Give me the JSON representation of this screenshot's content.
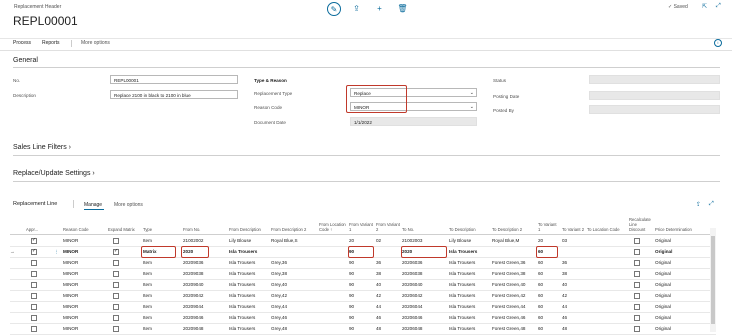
{
  "header": {
    "breadcrumb": "Replacement Header",
    "title": "REPL00001",
    "saved_label": "Saved",
    "icons": [
      "edit-icon",
      "share-icon",
      "add-icon",
      "delete-icon",
      "check-icon",
      "open-new-icon",
      "collapse-icon"
    ]
  },
  "actions": {
    "process": "Process",
    "reports": "Reports",
    "more": "More options"
  },
  "general": {
    "title": "General",
    "no_label": "No.",
    "no_value": "REPL00001",
    "desc_label": "Description",
    "desc_value": "Replace 2100 in black to 2100 in blue",
    "type_reason_title": "Type & Reason",
    "rtype_label": "Replacement Type",
    "rtype_value": "Replace",
    "reason_label": "Reason Code",
    "reason_value": "MINOR",
    "docdate_label": "Document Date",
    "docdate_value": "1/1/2022",
    "status_label": "Status",
    "posting_label": "Posting Date",
    "posted_label": "Posted By"
  },
  "sections": {
    "sales_filters": "Sales Line Filters",
    "replace_settings": "Replace/Update Settings"
  },
  "lines": {
    "title": "Replacement Line",
    "manage": "Manage",
    "more": "More options",
    "columns": [
      "Appr...",
      "Reason Code",
      "Expand Matrix",
      "Type",
      "From No.",
      "From Description",
      "From Description 2",
      "From Location Code ↑",
      "From Variant 1",
      "From Variant 2",
      "To No.",
      "To Description",
      "To Description 2",
      "To Variant 1",
      "To Variant 2",
      "To Location Code",
      "Recalculate Line Discount",
      "Price Determination"
    ],
    "rows": [
      {
        "appr": true,
        "reason": "MINOR",
        "expand": false,
        "type": "Item",
        "from_no": "21002002",
        "from_desc": "Lily Blouse",
        "from_desc2": "Royal Blue,S",
        "from_loc": "",
        "fv1": "20",
        "fv2": "02",
        "to_no": "21002003",
        "to_desc": "Lily Blouse",
        "to_desc2": "Royal Blue,M",
        "tv1": "20",
        "tv2": "03",
        "to_loc": "",
        "recalc": false,
        "price": "Original",
        "bold": false
      },
      {
        "appr": true,
        "reason": "MINOR",
        "expand": true,
        "type": "Matrix",
        "from_no": "2020",
        "from_desc": "Isla Trousers",
        "from_desc2": "",
        "from_loc": "",
        "fv1": "90",
        "fv2": "",
        "to_no": "2020",
        "to_desc": "Isla Trousers",
        "to_desc2": "",
        "tv1": "60",
        "tv2": "",
        "to_loc": "",
        "recalc": false,
        "price": "Original",
        "bold": true
      },
      {
        "appr": false,
        "reason": "MINOR",
        "expand": false,
        "type": "Item",
        "from_no": "20209036",
        "from_desc": "Isla Trousers",
        "from_desc2": "Grey,36",
        "from_loc": "",
        "fv1": "90",
        "fv2": "36",
        "to_no": "20206036",
        "to_desc": "Isla Trousers",
        "to_desc2": "Forest Green,36",
        "tv1": "60",
        "tv2": "36",
        "to_loc": "",
        "recalc": false,
        "price": "Original",
        "bold": false
      },
      {
        "appr": false,
        "reason": "MINOR",
        "expand": false,
        "type": "Item",
        "from_no": "20209038",
        "from_desc": "Isla Trousers",
        "from_desc2": "Grey,38",
        "from_loc": "",
        "fv1": "90",
        "fv2": "38",
        "to_no": "20206038",
        "to_desc": "Isla Trousers",
        "to_desc2": "Forest Green,38",
        "tv1": "60",
        "tv2": "38",
        "to_loc": "",
        "recalc": false,
        "price": "Original",
        "bold": false
      },
      {
        "appr": false,
        "reason": "MINOR",
        "expand": false,
        "type": "Item",
        "from_no": "20209040",
        "from_desc": "Isla Trousers",
        "from_desc2": "Grey,40",
        "from_loc": "",
        "fv1": "90",
        "fv2": "40",
        "to_no": "20206040",
        "to_desc": "Isla Trousers",
        "to_desc2": "Forest Green,40",
        "tv1": "60",
        "tv2": "40",
        "to_loc": "",
        "recalc": false,
        "price": "Original",
        "bold": false
      },
      {
        "appr": false,
        "reason": "MINOR",
        "expand": false,
        "type": "Item",
        "from_no": "20209042",
        "from_desc": "Isla Trousers",
        "from_desc2": "Grey,42",
        "from_loc": "",
        "fv1": "90",
        "fv2": "42",
        "to_no": "20206042",
        "to_desc": "Isla Trousers",
        "to_desc2": "Forest Green,42",
        "tv1": "60",
        "tv2": "42",
        "to_loc": "",
        "recalc": false,
        "price": "Original",
        "bold": false
      },
      {
        "appr": false,
        "reason": "MINOR",
        "expand": false,
        "type": "Item",
        "from_no": "20209044",
        "from_desc": "Isla Trousers",
        "from_desc2": "Grey,44",
        "from_loc": "",
        "fv1": "90",
        "fv2": "44",
        "to_no": "20206044",
        "to_desc": "Isla Trousers",
        "to_desc2": "Forest Green,44",
        "tv1": "60",
        "tv2": "44",
        "to_loc": "",
        "recalc": false,
        "price": "Original",
        "bold": false
      },
      {
        "appr": false,
        "reason": "MINOR",
        "expand": false,
        "type": "Item",
        "from_no": "20209046",
        "from_desc": "Isla Trousers",
        "from_desc2": "Grey,46",
        "from_loc": "",
        "fv1": "90",
        "fv2": "46",
        "to_no": "20206046",
        "to_desc": "Isla Trousers",
        "to_desc2": "Forest Green,46",
        "tv1": "60",
        "tv2": "46",
        "to_loc": "",
        "recalc": false,
        "price": "Original",
        "bold": false
      },
      {
        "appr": false,
        "reason": "MINOR",
        "expand": false,
        "type": "Item",
        "from_no": "20209048",
        "from_desc": "Isla Trousers",
        "from_desc2": "Grey,48",
        "from_loc": "",
        "fv1": "90",
        "fv2": "48",
        "to_no": "20206048",
        "to_desc": "Isla Trousers",
        "to_desc2": "Forest Green,48",
        "tv1": "60",
        "tv2": "48",
        "to_loc": "",
        "recalc": false,
        "price": "Original",
        "bold": false
      }
    ]
  },
  "colors": {
    "accent": "#0a6b9c",
    "highlight": "#c0392b"
  }
}
